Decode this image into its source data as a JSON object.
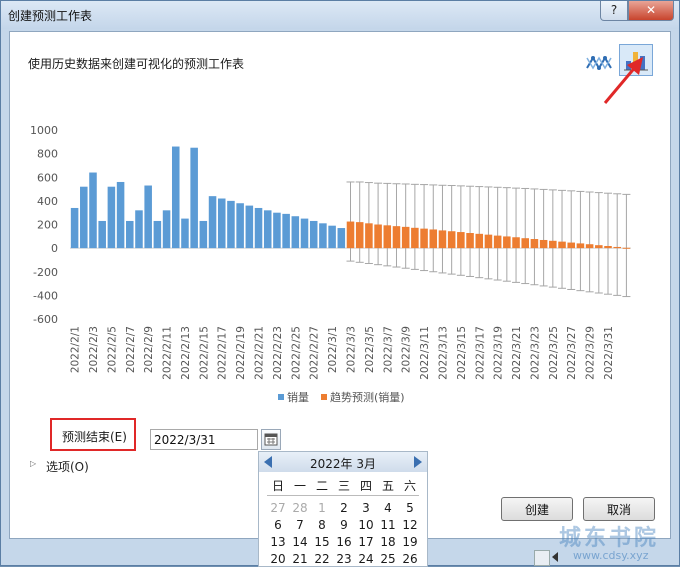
{
  "window": {
    "title": "创建预测工作表",
    "help_label": "?",
    "close_label": "✕"
  },
  "subtitle": "使用历史数据来创建可视化的预测工作表",
  "view_buttons": {
    "line_icon": "line-chart-icon",
    "column_icon": "column-chart-icon",
    "active": "column"
  },
  "forecast_end": {
    "label": "预测结束(E)",
    "value": "2022/3/31"
  },
  "options": {
    "label": "选项(O)"
  },
  "buttons": {
    "create": "创建",
    "cancel": "取消"
  },
  "calendar": {
    "title": "2022年 3月",
    "weekdays": [
      "日",
      "一",
      "二",
      "三",
      "四",
      "五",
      "六"
    ],
    "rows": [
      [
        "27",
        "28",
        "1",
        "2",
        "3",
        "4",
        "5"
      ],
      [
        "6",
        "7",
        "8",
        "9",
        "10",
        "11",
        "12"
      ],
      [
        "13",
        "14",
        "15",
        "16",
        "17",
        "18",
        "19"
      ],
      [
        "20",
        "21",
        "22",
        "23",
        "24",
        "25",
        "26"
      ]
    ],
    "muted": [
      [
        0,
        0
      ],
      [
        0,
        1
      ],
      [
        0,
        2
      ]
    ]
  },
  "watermark": {
    "text": "城东书院",
    "url": "www.cdsy.xyz"
  },
  "colors": {
    "actual": "#5b9bd5",
    "forecast": "#ed7d31",
    "bound": "#a6a6a6",
    "highlight": "#e02828"
  },
  "chart_data": {
    "type": "bar",
    "ylim": [
      -600,
      1000
    ],
    "yticks": [
      1000,
      800,
      600,
      400,
      200,
      0,
      -200,
      -400,
      -600
    ],
    "grid": false,
    "legend_position": "bottom",
    "legend": [
      "销量",
      "趋势预测(销量)"
    ],
    "x_tick_labels": [
      "2022/2/1",
      "2022/2/3",
      "2022/2/5",
      "2022/2/7",
      "2022/2/9",
      "2022/2/11",
      "2022/2/13",
      "2022/2/15",
      "2022/2/17",
      "2022/2/19",
      "2022/2/21",
      "2022/2/23",
      "2022/2/25",
      "2022/2/27",
      "2022/3/1",
      "2022/3/3",
      "2022/3/5",
      "2022/3/7",
      "2022/3/9",
      "2022/3/11",
      "2022/3/13",
      "2022/3/15",
      "2022/3/17",
      "2022/3/19",
      "2022/3/21",
      "2022/3/23",
      "2022/3/25",
      "2022/3/27",
      "2022/3/29",
      "2022/3/31"
    ],
    "actual": [
      340,
      520,
      640,
      230,
      520,
      560,
      230,
      320,
      530,
      230,
      320,
      860,
      250,
      850,
      230,
      440,
      420,
      400,
      380,
      360,
      340,
      320,
      300,
      290,
      270,
      250,
      230,
      210,
      190,
      170
    ],
    "forecast": [
      225,
      220,
      210,
      200,
      193,
      186,
      180,
      172,
      165,
      158,
      150,
      143,
      136,
      128,
      121,
      114,
      106,
      99,
      92,
      84,
      77,
      69,
      62,
      55,
      47,
      40,
      33,
      25,
      18,
      10,
      3
    ],
    "forecast_upper_bound": [
      560,
      560,
      555,
      550,
      548,
      545,
      543,
      540,
      538,
      535,
      532,
      530,
      527,
      524,
      521,
      518,
      515,
      512,
      508,
      505,
      501,
      497,
      493,
      489,
      485,
      480,
      475,
      470,
      465,
      460,
      455
    ],
    "forecast_lower_bound": [
      -110,
      -120,
      -130,
      -140,
      -150,
      -160,
      -170,
      -180,
      -190,
      -200,
      -210,
      -220,
      -230,
      -240,
      -250,
      -260,
      -270,
      -280,
      -290,
      -300,
      -310,
      -320,
      -330,
      -340,
      -350,
      -360,
      -370,
      -380,
      -390,
      -400,
      -410
    ]
  }
}
